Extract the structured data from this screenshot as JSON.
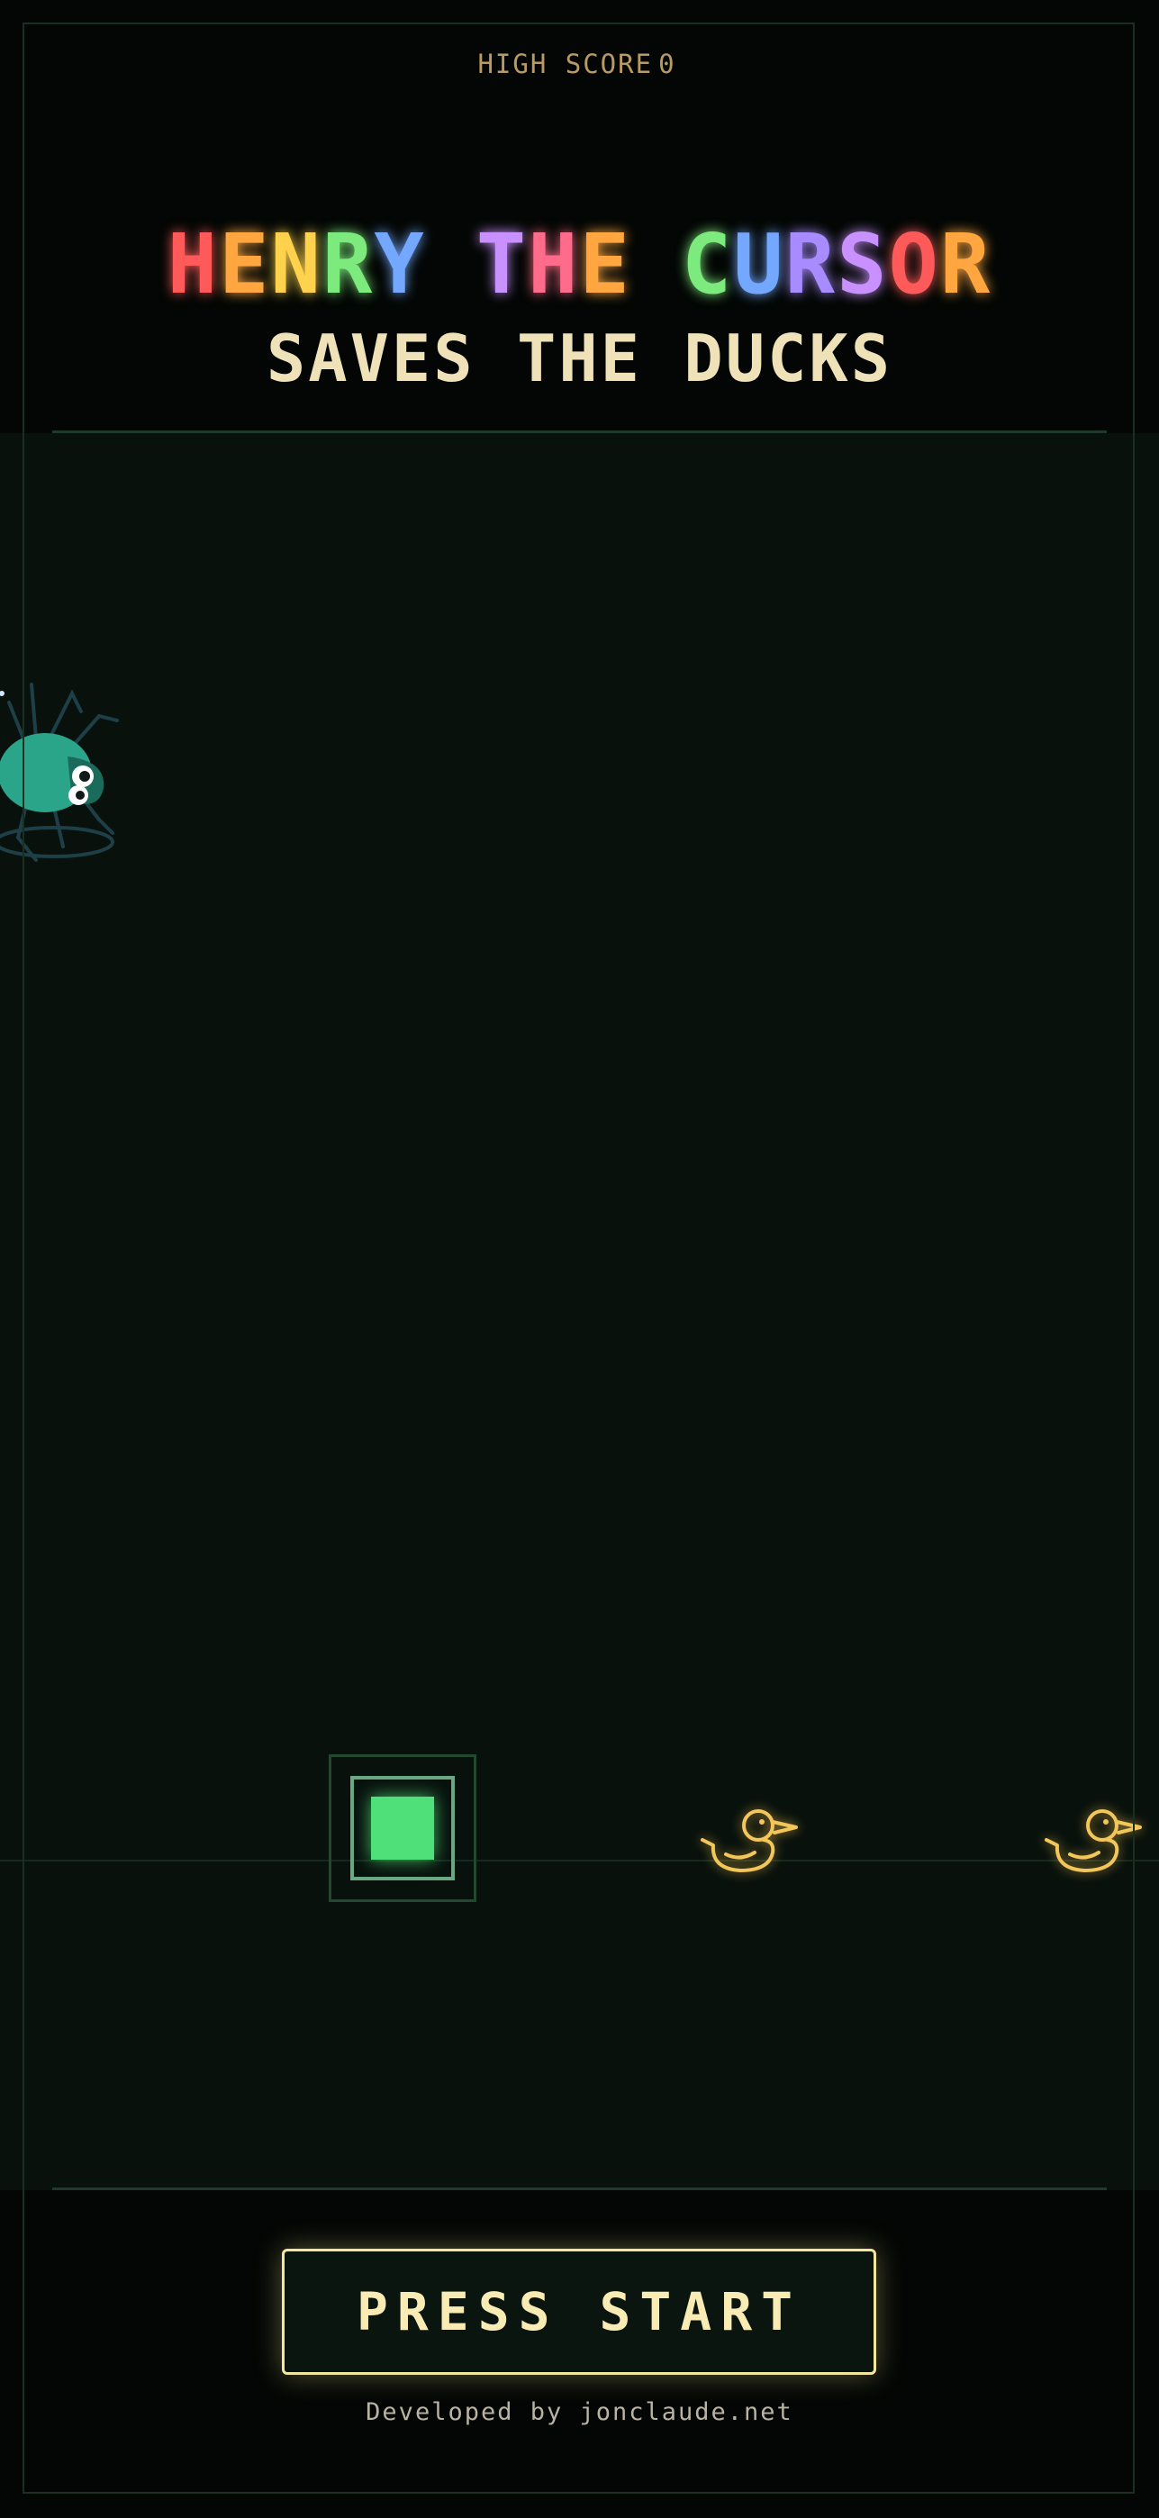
{
  "hud": {
    "high_score_label": "HIGH SCORE",
    "high_score_value": "0"
  },
  "title": {
    "line1": [
      {
        "ch": "H",
        "color": "#ff5a5a"
      },
      {
        "ch": "E",
        "color": "#ffa640"
      },
      {
        "ch": "N",
        "color": "#ffd24d"
      },
      {
        "ch": "R",
        "color": "#7dea7d"
      },
      {
        "ch": "Y",
        "color": "#74a8ff"
      },
      {
        "ch": " ",
        "color": ""
      },
      {
        "ch": "T",
        "color": "#c990ff"
      },
      {
        "ch": "H",
        "color": "#ff6b8a"
      },
      {
        "ch": "E",
        "color": "#ffa640"
      },
      {
        "ch": " ",
        "color": ""
      },
      {
        "ch": "C",
        "color": "#7dea7d"
      },
      {
        "ch": "U",
        "color": "#74a8ff"
      },
      {
        "ch": "R",
        "color": "#a88bff"
      },
      {
        "ch": "S",
        "color": "#c990ff"
      },
      {
        "ch": "O",
        "color": "#ff5a5a"
      },
      {
        "ch": "R",
        "color": "#ffa640"
      }
    ],
    "line2": "SAVES THE DUCKS"
  },
  "start_button": {
    "label": "PRESS START"
  },
  "footer": {
    "credit": "Developed by jonclaude.net"
  },
  "colors": {
    "background": "#030604",
    "playfield": "#08110c",
    "cursor": "#4fe07a",
    "duck": "#f3c65a",
    "spider": "#2aa58a",
    "accent": "#f5e79a"
  },
  "sprites": {
    "spider": "spider-icon",
    "cursor": "cursor-block",
    "ducks": [
      "duck-icon",
      "duck-icon"
    ]
  }
}
